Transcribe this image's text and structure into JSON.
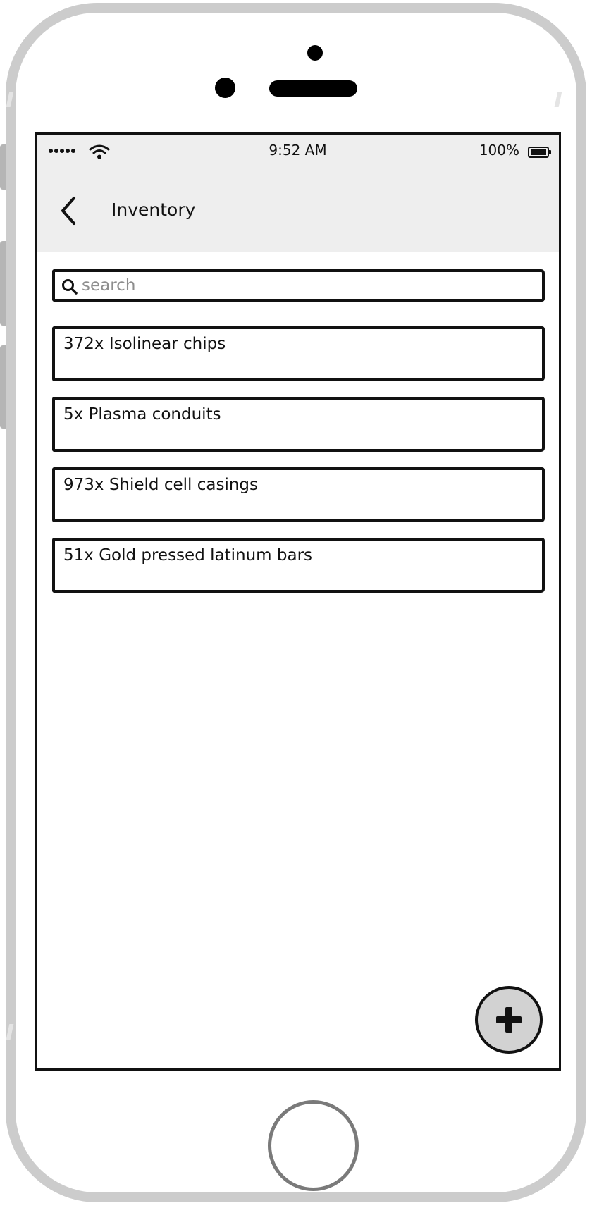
{
  "status_bar": {
    "time": "9:52 AM",
    "battery_percent": "100%",
    "battery_level": 1.0,
    "signal_icon": "signal-dots-icon",
    "wifi_icon": "wifi-icon",
    "battery_icon": "battery-full-icon"
  },
  "nav": {
    "title": "Inventory",
    "back_icon": "chevron-left-icon"
  },
  "search": {
    "placeholder": "search",
    "value": "",
    "icon": "search-icon"
  },
  "items": [
    {
      "label": "372x Isolinear chips"
    },
    {
      "label": "5x Plasma conduits"
    },
    {
      "label": "973x Shield cell casings"
    },
    {
      "label": "51x Gold pressed latinum bars"
    }
  ],
  "fab": {
    "icon": "plus-icon"
  },
  "colors": {
    "header_background": "#eeeeee",
    "fab_background": "#d2d2d2",
    "device_frame": "#cccccc",
    "outline": "#111111"
  }
}
